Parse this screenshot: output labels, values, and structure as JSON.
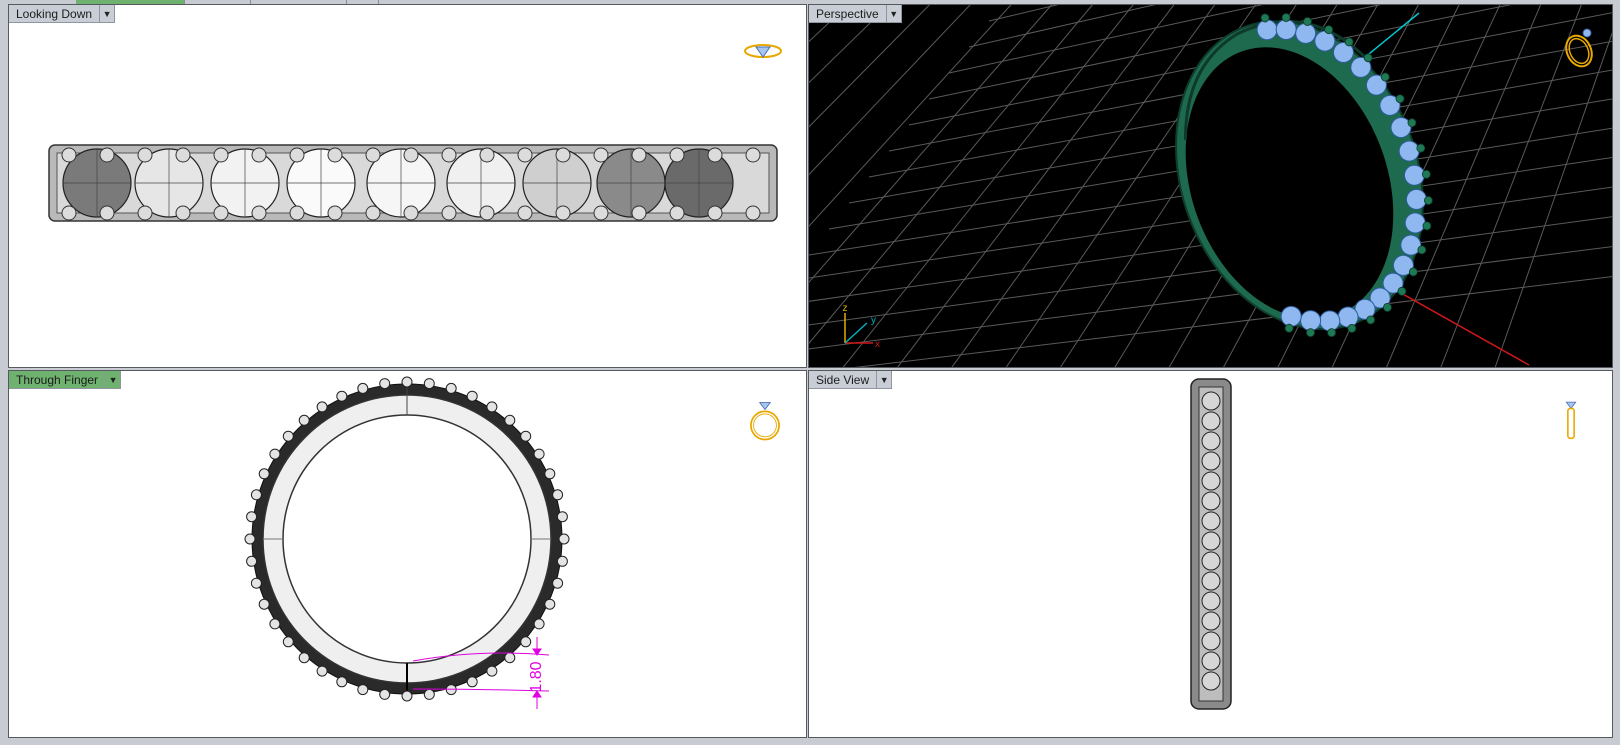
{
  "viewports": {
    "top_left": {
      "title": "Looking Down"
    },
    "top_right": {
      "title": "Perspective",
      "axis_z": "z",
      "axis_y": "y",
      "axis_x": "x"
    },
    "bottom_left": {
      "title": "Through Finger",
      "dimension": "1.80"
    },
    "bottom_right": {
      "title": "Side View"
    }
  },
  "colors": {
    "active_tab": "#6fb26f",
    "tab": "#c9ced6",
    "ring_green": "#1e6b50",
    "stone_blue": "#8fb8f0",
    "dimension_magenta": "#e000e0",
    "icon_gold": "#e8a800"
  },
  "icons": [
    "dropdown-arrow-icon",
    "ring-top-icon",
    "ring-perspective-icon",
    "ring-front-icon",
    "ring-side-icon"
  ]
}
